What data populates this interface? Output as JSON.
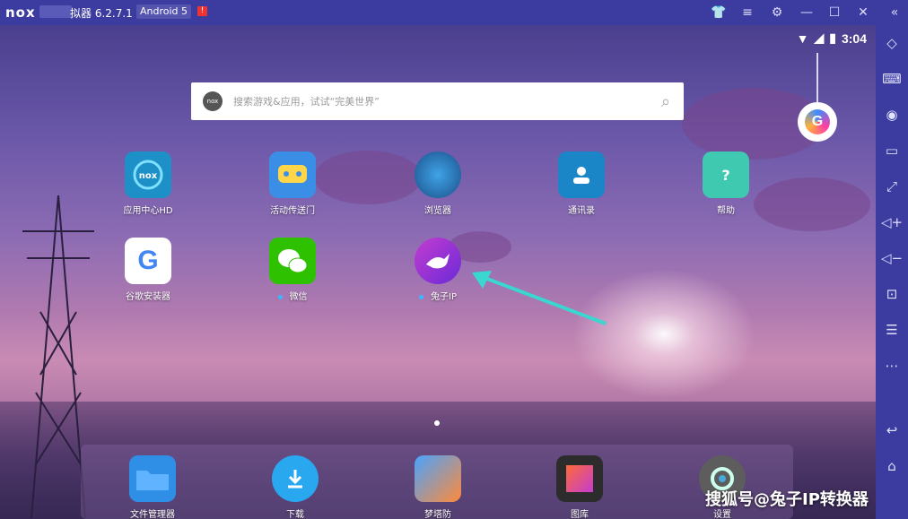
{
  "titlebar": {
    "logo": "nox",
    "title": "拟器 6.2.7.1",
    "android_badge": "Android 5",
    "warn": "!",
    "buttons": [
      "shirt-icon",
      "menu-icon",
      "gear-icon",
      "minimize-icon",
      "maximize-icon",
      "close-icon",
      "collapse-icon"
    ]
  },
  "status": {
    "time": "3:04"
  },
  "search": {
    "placeholder": "搜索游戏&应用，试试“完美世界”",
    "logo": "nox"
  },
  "apps": [
    {
      "label": "应用中心HD",
      "icon": "nox-appcenter-icon",
      "color": "#1e90c8"
    },
    {
      "label": "活动传送门",
      "icon": "gamepad-icon",
      "color": "#3a8ee6"
    },
    {
      "label": "浏览器",
      "icon": "globe-icon",
      "color": "#2a6fb0"
    },
    {
      "label": "通讯录",
      "icon": "contacts-icon",
      "color": "#1a86c8"
    },
    {
      "label": "帮助",
      "icon": "help-icon",
      "color": "#3fc9b0"
    },
    {
      "label": "谷歌安装器",
      "icon": "google-icon",
      "color": "#ffffff"
    },
    {
      "label": "微信",
      "icon": "wechat-icon",
      "color": "#2dc100"
    },
    {
      "label": "兔子IP",
      "icon": "rabbit-icon",
      "color": "#8a2be2"
    }
  ],
  "dock": [
    {
      "label": "文件管理器",
      "icon": "folder-icon",
      "color": "#2f8fe6"
    },
    {
      "label": "下载",
      "icon": "download-icon",
      "color": "#29a8f0"
    },
    {
      "label": "梦塔防",
      "icon": "game-icon",
      "color": "#6a4aa0"
    },
    {
      "label": "图库",
      "icon": "gallery-icon",
      "color": "#444"
    },
    {
      "label": "设置",
      "icon": "settings-icon",
      "color": "#6a6a6a"
    }
  ],
  "watermark": "搜狐号@兔子IP转换器",
  "sidebar": [
    "rotate-icon",
    "keyboard-icon",
    "location-icon",
    "screen-icon",
    "fullscreen-icon",
    "volume-up-icon",
    "volume-down-icon",
    "screenshot-icon",
    "shake-icon",
    "more-icon",
    "back-icon",
    "home-icon"
  ]
}
